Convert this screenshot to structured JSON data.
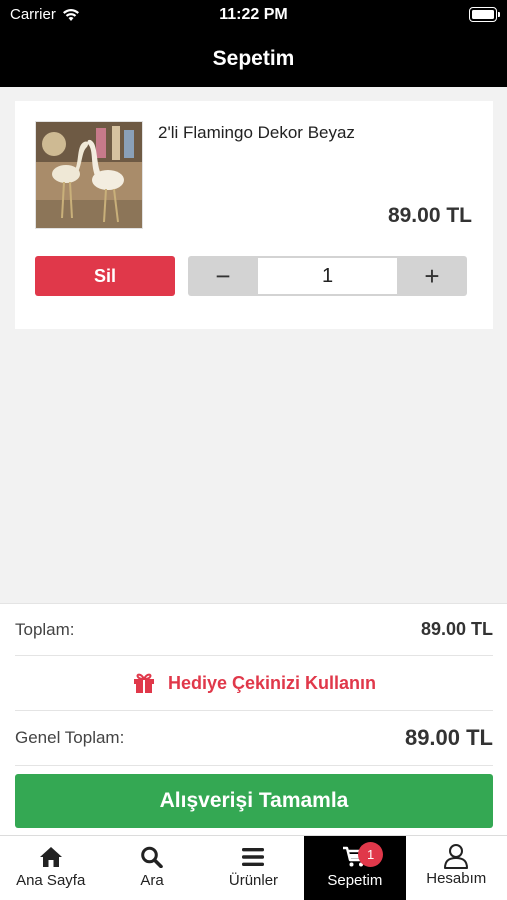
{
  "status_bar": {
    "carrier": "Carrier",
    "time": "11:22 PM"
  },
  "header": {
    "title": "Sepetim"
  },
  "cart": {
    "items": [
      {
        "name": "2'li Flamingo Dekor Beyaz",
        "price": "89.00 TL",
        "delete_label": "Sil",
        "decrement": "−",
        "quantity": "1",
        "increment": "+"
      }
    ]
  },
  "summary": {
    "subtotal_label": "Toplam:",
    "subtotal_value": "89.00 TL",
    "gift_label": "Hediye Çekinizi Kullanın",
    "grand_total_label": "Genel Toplam:",
    "grand_total_value": "89.00 TL",
    "checkout_label": "Alışverişi Tamamla"
  },
  "tabs": [
    {
      "label": "Ana Sayfa",
      "icon": "home-icon"
    },
    {
      "label": "Ara",
      "icon": "search-icon"
    },
    {
      "label": "Ürünler",
      "icon": "menu-icon"
    },
    {
      "label": "Sepetim",
      "icon": "cart-icon",
      "active": true,
      "badge": "1"
    },
    {
      "label": "Hesabım",
      "icon": "user-icon"
    }
  ],
  "colors": {
    "accent_red": "#e0384a",
    "checkout_green": "#34a853",
    "header_black": "#000000"
  }
}
